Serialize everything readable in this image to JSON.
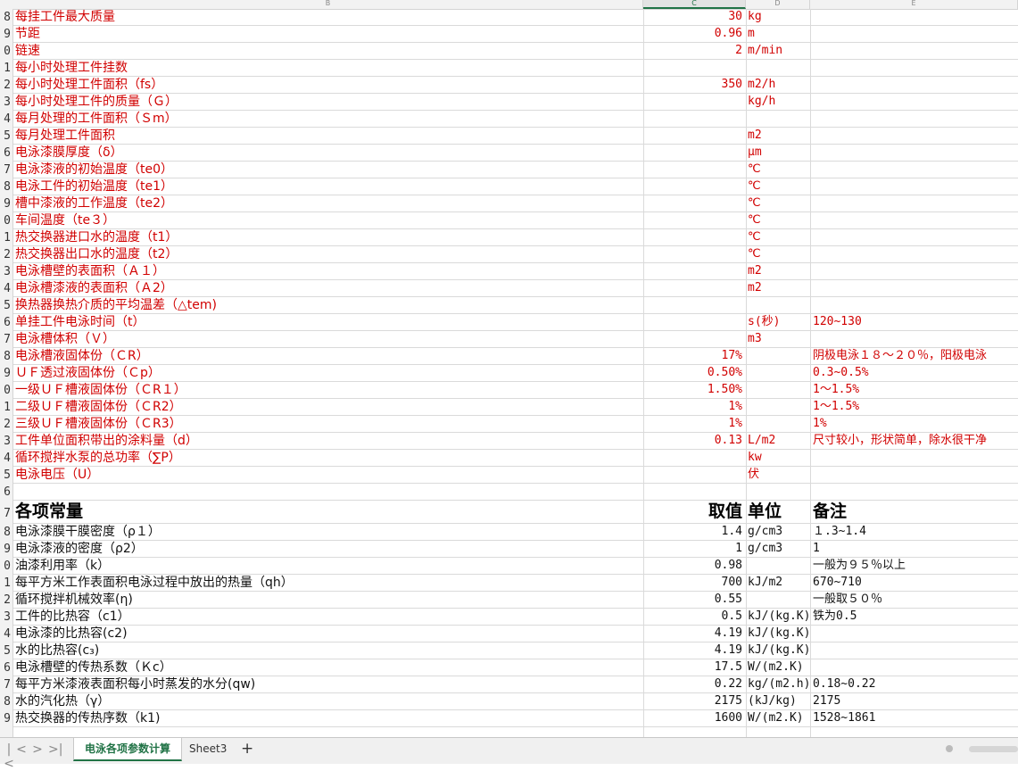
{
  "columns": {
    "B": "B",
    "C": "C",
    "D": "D",
    "E": "E"
  },
  "row_numbers": [
    "8",
    "9",
    "0",
    "1",
    "2",
    "3",
    "4",
    "5",
    "6",
    "7",
    "8",
    "9",
    "0",
    "1",
    "2",
    "3",
    "4",
    "5",
    "6",
    "7",
    "8",
    "9",
    "0",
    "1",
    "2",
    "3",
    "4",
    "5",
    "6",
    "7",
    "8",
    "9",
    "0",
    "1",
    "2",
    "3",
    "4",
    "5",
    "6",
    "7",
    "8",
    "9"
  ],
  "rows": [
    {
      "b": "每挂工件最大质量",
      "c": "30",
      "d": "kg",
      "e": "",
      "color": "red"
    },
    {
      "b": "节距",
      "c": "0.96",
      "d": "m",
      "e": "",
      "color": "red"
    },
    {
      "b": "链速",
      "c": "2",
      "d": "m/min",
      "e": "",
      "color": "red"
    },
    {
      "b": "每小时处理工件挂数",
      "c": "",
      "d": "",
      "e": "",
      "color": "red"
    },
    {
      "b": "每小时处理工件面积（fs）",
      "c": "350",
      "d": "m2/h",
      "e": "",
      "color": "red"
    },
    {
      "b": "每小时处理工件的质量（Ｇ）",
      "c": "",
      "d": "kg/h",
      "e": "",
      "color": "red"
    },
    {
      "b": "每月处理的工件面积（Ｓm）",
      "c": "",
      "d": "",
      "e": "",
      "color": "red"
    },
    {
      "b": "每月处理工件面积",
      "c": "",
      "d": "m2",
      "e": "",
      "color": "red"
    },
    {
      "b": "电泳漆膜厚度（δ）",
      "c": "",
      "d": "μm",
      "e": "",
      "color": "red"
    },
    {
      "b": "电泳漆液的初始温度（te0）",
      "c": "",
      "d": "℃",
      "e": "",
      "color": "red"
    },
    {
      "b": "电泳工件的初始温度（te1）",
      "c": "",
      "d": "℃",
      "e": "",
      "color": "red"
    },
    {
      "b": "槽中漆液的工作温度（te2）",
      "c": "",
      "d": "℃",
      "e": "",
      "color": "red"
    },
    {
      "b": "车间温度（te３）",
      "c": "",
      "d": "℃",
      "e": "",
      "color": "red"
    },
    {
      "b": "热交换器进口水的温度（t1）",
      "c": "",
      "d": "℃",
      "e": "",
      "color": "red"
    },
    {
      "b": "热交换器出口水的温度（t2）",
      "c": "",
      "d": "℃",
      "e": "",
      "color": "red"
    },
    {
      "b": "电泳槽壁的表面积（Ａ１）",
      "c": "",
      "d": "m2",
      "e": "",
      "color": "red"
    },
    {
      "b": "电泳槽漆液的表面积（Ａ2）",
      "c": "",
      "d": "m2",
      "e": "",
      "color": "red"
    },
    {
      "b": "换热器换热介质的平均温差（△tem)",
      "c": "",
      "d": "",
      "e": "",
      "color": "red"
    },
    {
      "b": "单挂工件电泳时间（t）",
      "c": "",
      "d": "s(秒)",
      "e": "120~130",
      "color": "red"
    },
    {
      "b": "电泳槽体积（Ｖ）",
      "c": "",
      "d": "m3",
      "e": "",
      "color": "red"
    },
    {
      "b": "电泳槽液固体份（ＣR）",
      "c": "17%",
      "d": "",
      "e": "阴极电泳１８～２０％，阳极电泳",
      "color": "red"
    },
    {
      "b": "ＵＦ透过液固体份（Ｃp）",
      "c": "0.50%",
      "d": "",
      "e": "0.3~0.5%",
      "color": "red"
    },
    {
      "b": "一级ＵＦ槽液固体份（ＣR１）",
      "c": "1.50%",
      "d": "",
      "e": "1～1.5%",
      "color": "red"
    },
    {
      "b": "二级ＵＦ槽液固体份（ＣR2）",
      "c": "1%",
      "d": "",
      "e": "1～1.5%",
      "color": "red"
    },
    {
      "b": "三级ＵＦ槽液固体份（ＣR3）",
      "c": "1%",
      "d": "",
      "e": "1%",
      "color": "red"
    },
    {
      "b": "工件单位面积带出的涂料量（d）",
      "c": "0.13",
      "d": "L/m2",
      "e": "尺寸较小，形状简单，除水很干净",
      "color": "red"
    },
    {
      "b": "循环搅拌水泵的总功率（∑P）",
      "c": "",
      "d": "kw",
      "e": "",
      "color": "red"
    },
    {
      "b": "电泳电压（U）",
      "c": "",
      "d": "伏",
      "e": "",
      "color": "red"
    },
    {
      "b": "",
      "c": "",
      "d": "",
      "e": "",
      "color": "black"
    },
    {
      "b": "各项常量",
      "c": "取值",
      "d": "单位",
      "e": "备注",
      "color": "black",
      "header": true
    },
    {
      "b": "电泳漆膜干膜密度（ρ１）",
      "c": "1.4",
      "d": "g/cm3",
      "e": "１.3~1.4",
      "color": "black"
    },
    {
      "b": "电泳漆液的密度（ρ2）",
      "c": "1",
      "d": "g/cm3",
      "e": "1",
      "color": "black"
    },
    {
      "b": "油漆利用率（k）",
      "c": "0.98",
      "d": "",
      "e": "一般为９５％以上",
      "color": "black"
    },
    {
      "b": "每平方米工作表面积电泳过程中放出的热量（qh）",
      "c": "700",
      "d": "kJ/m2",
      "e": "670~710",
      "color": "black"
    },
    {
      "b": "循环搅拌机械效率(η)",
      "c": "0.55",
      "d": "",
      "e": "一般取５０％",
      "color": "black"
    },
    {
      "b": "工件的比热容（c1）",
      "c": "0.5",
      "d": "kJ/(kg.K)",
      "e": "铁为0.5",
      "color": "black"
    },
    {
      "b": "电泳漆的比热容(c2)",
      "c": "4.19",
      "d": "kJ/(kg.K)",
      "e": "",
      "color": "black"
    },
    {
      "b": "水的比热容(c₃)",
      "c": "4.19",
      "d": "kJ/(kg.K)",
      "e": "",
      "color": "black"
    },
    {
      "b": "电泳槽壁的传热系数（Ｋc）",
      "c": "17.5",
      "d": "W/(m2.K)",
      "e": "",
      "color": "black"
    },
    {
      "b": "每平方米漆液表面积每小时蒸发的水分(qw)",
      "c": "0.22",
      "d": "kg/(m2.h)",
      "e": "0.18~0.22",
      "color": "black"
    },
    {
      "b": "水的汽化热（γ）",
      "c": "2175",
      "d": "(kJ/kg)",
      "e": "2175",
      "color": "black"
    },
    {
      "b": "热交换器的传热序数（k1)",
      "c": "1600",
      "d": "W/(m2.K)",
      "e": "1528~1861",
      "color": "black"
    }
  ],
  "tabs": {
    "active": "电泳各项参数计算",
    "other": "Sheet3",
    "add": "+"
  },
  "nav": {
    "first": "|<",
    "prev": "<",
    "next": ">",
    "last": ">|"
  },
  "colors": {
    "red": "#d10000",
    "accent": "#217346"
  }
}
